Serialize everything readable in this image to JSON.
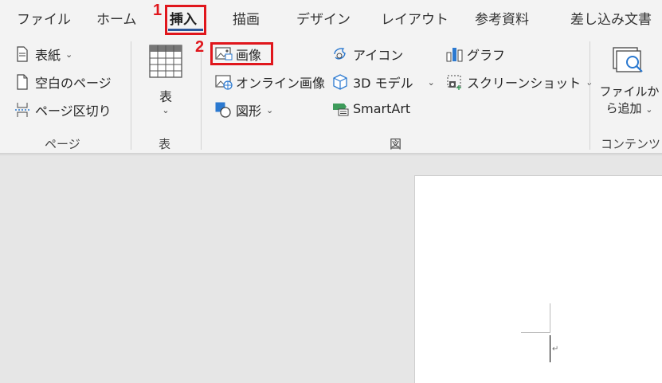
{
  "tabs": [
    "ファイル",
    "ホーム",
    "挿入",
    "描画",
    "デザイン",
    "レイアウト",
    "参考資料",
    "差し込み文書"
  ],
  "callouts": {
    "one": "1",
    "two": "2"
  },
  "pages_group": {
    "cover": "表紙",
    "blank": "空白のページ",
    "page_break": "ページ区切り",
    "label": "ページ"
  },
  "table_group": {
    "table": "表",
    "label": "表"
  },
  "illustrations_group": {
    "picture": "画像",
    "online_picture": "オンライン画像",
    "shapes": "図形",
    "icons": "アイコン",
    "models_3d": "3D モデル",
    "smartart": "SmartArt",
    "chart": "グラフ",
    "screenshot": "スクリーンショット",
    "label": "図"
  },
  "content_group": {
    "add_from_file_line1": "ファイルか",
    "add_from_file_line2": "ら追加",
    "label": "コンテンツ"
  },
  "document": {
    "paragraph_mark": "↵"
  },
  "colors": {
    "accent": "#2b579a",
    "callout": "#e0161c"
  }
}
